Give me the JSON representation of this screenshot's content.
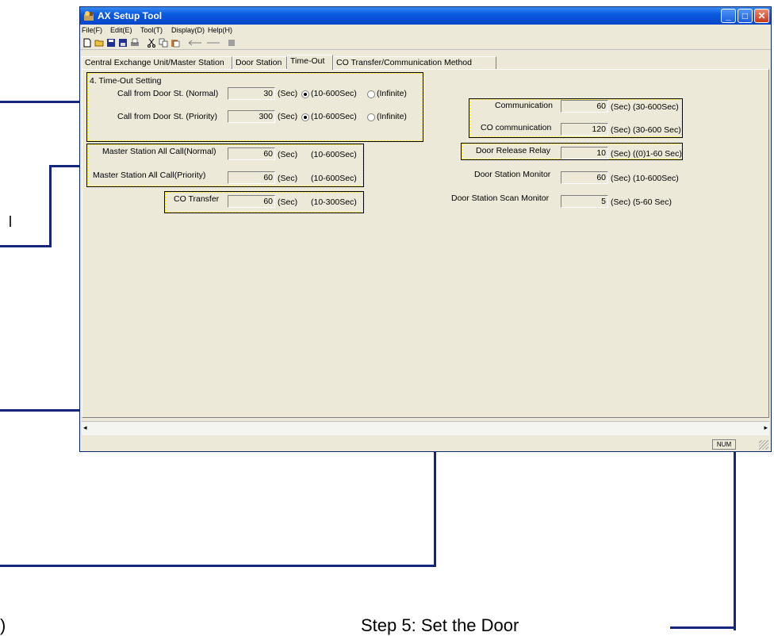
{
  "window": {
    "title": "AX Setup Tool",
    "minimize": "_",
    "maximize": "□",
    "close": "✕"
  },
  "menu": [
    "File(F)",
    "Edit(E)",
    "Tool(T)",
    "Display(D)",
    "Help(H)"
  ],
  "toolbar": [
    "new-icon",
    "open-icon",
    "save-icon",
    "save-as-icon",
    "print-icon",
    "cut-icon",
    "copy-icon",
    "paste-icon",
    "back-icon",
    "forward-icon",
    "stop-icon"
  ],
  "tabs": [
    "Central Exchange Unit/Master Station",
    "Door Station",
    "Time-Out",
    "CO Transfer/Communication Method"
  ],
  "active_tab": "Time-Out",
  "section_title": "4. Time-Out Setting",
  "left": {
    "call_normal": {
      "label": "Call from Door St. (Normal)",
      "value": "30",
      "unit": "(Sec)",
      "opt1": "(10-600Sec)",
      "opt2": "(Infinite)"
    },
    "call_priority": {
      "label": "Call from Door St. (Priority)",
      "value": "300",
      "unit": "(Sec)",
      "opt1": "(10-600Sec)",
      "opt2": "(Infinite)"
    },
    "allcall_normal": {
      "label": "Master Station All Call(Normal)",
      "value": "60",
      "unit": "(Sec)",
      "range": "(10-600Sec)"
    },
    "allcall_priority": {
      "label": "Master Station All Call(Priority)",
      "value": "60",
      "unit": "(Sec)",
      "range": "(10-600Sec)"
    },
    "co_transfer": {
      "label": "CO Transfer",
      "value": "60",
      "unit": "(Sec)",
      "range": "(10-300Sec)"
    }
  },
  "right": {
    "communication": {
      "label": "Communication",
      "value": "60",
      "unit": "(Sec)",
      "range": "(30-600Sec)"
    },
    "co_communication": {
      "label": "CO communication",
      "value": "120",
      "unit": "(Sec)",
      "range": "(30-600 Sec)"
    },
    "door_release": {
      "label": "Door Release Relay",
      "value": "10",
      "unit": "(Sec)",
      "range": "((0)1-60 Sec)"
    },
    "door_monitor": {
      "label": "Door Station Monitor",
      "value": "60",
      "unit": "(Sec)",
      "range": "(10-600Sec)"
    },
    "door_scan": {
      "label": "Door Station Scan Monitor",
      "value": "5",
      "unit": "(Sec)",
      "range": "(5-60 Sec)"
    }
  },
  "status": {
    "num": "NUM"
  },
  "captions": {
    "step5": "Step 5:  Set the Door",
    "left_frag": ")"
  }
}
